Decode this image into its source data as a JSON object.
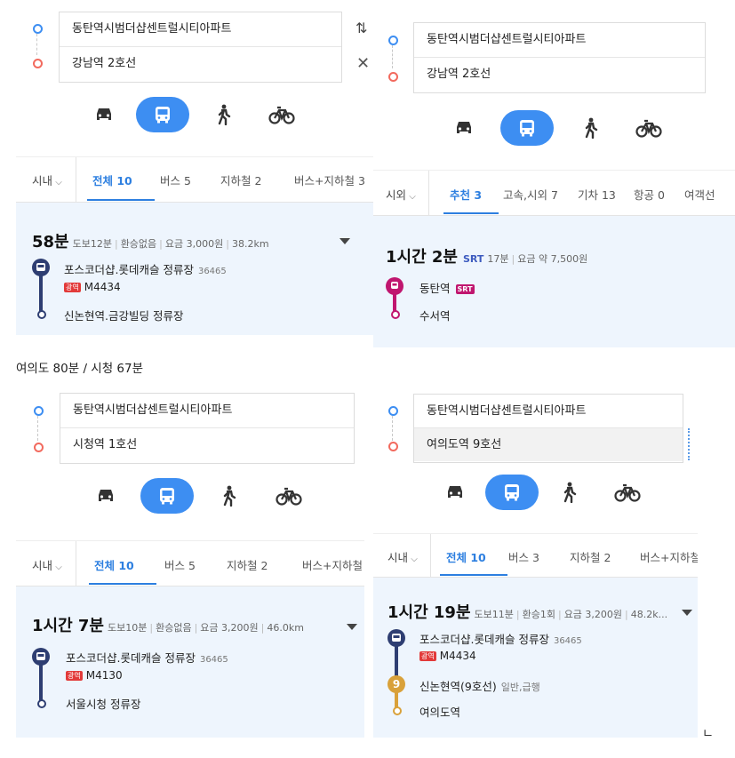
{
  "panels": {
    "tl": {
      "origin": "동탄역시범더샵센트럴시티아파트",
      "destination": "강남역 2호선",
      "tabs": [
        "시내",
        "전체 10",
        "버스 5",
        "지하철 2",
        "버스+지하철 3"
      ],
      "result": {
        "time": "58분",
        "meta": [
          "도보12분",
          "환승없음",
          "요금 3,000원",
          "38.2km"
        ],
        "stop1": "포스코더샵.롯데캐슬 정류장",
        "stop1_id": "36465",
        "badge": "광역",
        "line": "M4434",
        "stop2": "신논현역.금강빌딩 정류장"
      }
    },
    "tr": {
      "origin": "동탄역시범더샵센트럴시티아파트",
      "destination": "강남역 2호선",
      "tabs": [
        "시외",
        "추천 3",
        "고속,시외 7",
        "기차 13",
        "항공 0",
        "여객선"
      ],
      "result": {
        "time": "1시간 2분",
        "srt": "SRT",
        "meta": [
          "17분",
          "요금 약 7,500원"
        ],
        "stop1": "동탄역",
        "badge": "SRT",
        "stop2": "수서역"
      }
    },
    "bl": {
      "origin": "동탄역시범더샵센트럴시티아파트",
      "destination": "시청역 1호선",
      "tabs": [
        "시내",
        "전체 10",
        "버스 5",
        "지하철 2",
        "버스+지하철"
      ],
      "result": {
        "time": "1시간 7분",
        "meta": [
          "도보10분",
          "환승없음",
          "요금 3,200원",
          "46.0km"
        ],
        "stop1": "포스코더샵.롯데캐슬 정류장",
        "stop1_id": "36465",
        "badge": "광역",
        "line": "M4130",
        "stop2": "서울시청 정류장"
      }
    },
    "br": {
      "origin": "동탄역시범더샵센트럴시티아파트",
      "destination": "여의도역 9호선",
      "tabs": [
        "시내",
        "전체 10",
        "버스 3",
        "지하철 2",
        "버스+지하철"
      ],
      "result": {
        "time": "1시간 19분",
        "meta": [
          "도보11분",
          "환승1회",
          "요금 3,200원",
          "48.2k..."
        ],
        "stop1": "포스코더샵.롯데캐슬 정류장",
        "stop1_id": "36465",
        "badge": "광역",
        "line": "M4434",
        "stop2": "신논현역(9호선)",
        "stop2_note": "일반,급행",
        "line9": "9",
        "stop3": "여의도역"
      }
    }
  },
  "note": "여의도 80분 / 시청 67분",
  "corner": "ㄴ",
  "icons": {
    "car": "car-icon",
    "bus": "bus-icon",
    "walk": "walk-icon",
    "bike": "bike-icon",
    "swap": "swap-icon",
    "close": "close-icon",
    "dropdown": "caret-down-icon"
  },
  "colors": {
    "accent": "#3d8ef2",
    "selected_tab": "#2d7fe0",
    "bus_route": "#2e3e72",
    "srt": "#c0166f",
    "line9": "#d9a13a",
    "result_bg": "#eef5fd"
  }
}
